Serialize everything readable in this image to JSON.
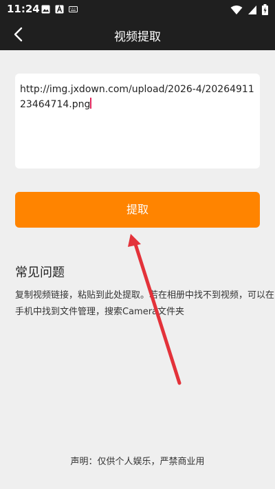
{
  "status_bar": {
    "time": "11:24",
    "left_icons": [
      "image-icon",
      "text-a-icon",
      "keyboard-icon"
    ],
    "right_icons": [
      "wifi-icon",
      "signal-icon",
      "battery-icon"
    ]
  },
  "toolbar": {
    "title": "视频提取",
    "back_icon": "back-arrow-icon"
  },
  "url_input": {
    "value": "http://img.jxdown.com/upload/2026-4/2026491123464714.png"
  },
  "extract_button": {
    "label": "提取"
  },
  "faq": {
    "title": "常见问题",
    "body": "复制视频链接，粘贴到此处提取。若在相册中找不到视频，可以在手机中找到文件管理，搜索Camera文件夹"
  },
  "disclaimer": "声明：仅供个人娱乐，严禁商业用",
  "colors": {
    "toolbar_bg": "#1f1f1f",
    "page_bg": "#efefef",
    "accent": "#ff8400",
    "arrow": "#e3323a"
  }
}
